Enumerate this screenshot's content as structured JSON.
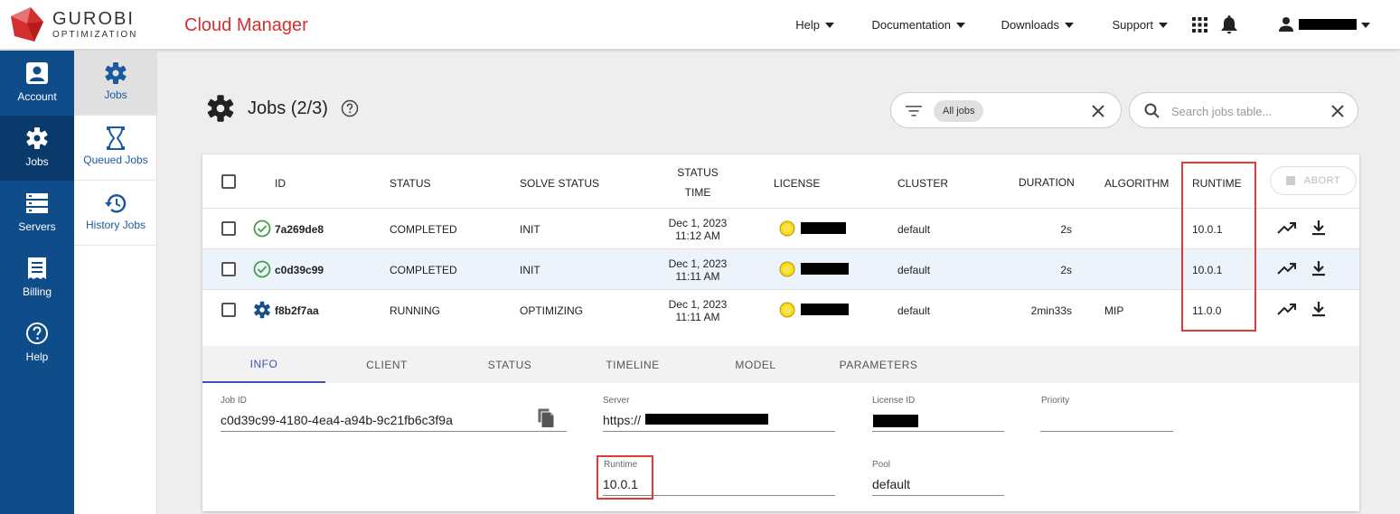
{
  "header": {
    "logo_main": "GUROBI",
    "logo_sub": "OPTIMIZATION",
    "app_title": "Cloud Manager",
    "nav": [
      "Help",
      "Documentation",
      "Downloads",
      "Support"
    ]
  },
  "sidebar": {
    "primary": [
      "Account",
      "Jobs",
      "Servers",
      "Billing",
      "Help"
    ],
    "secondary": [
      "Jobs",
      "Queued Jobs",
      "History Jobs"
    ]
  },
  "page": {
    "title": "Jobs (2/3)",
    "filter_chip": "All jobs",
    "search_placeholder": "Search jobs table..."
  },
  "table": {
    "columns": {
      "id": "ID",
      "status": "STATUS",
      "solve_status": "SOLVE STATUS",
      "status_time_1": "STATUS",
      "status_time_2": "TIME",
      "license": "LICENSE",
      "cluster": "CLUSTER",
      "duration": "DURATION",
      "algorithm": "ALGORITHM",
      "runtime": "RUNTIME"
    },
    "abort_label": "ABORT",
    "rows": [
      {
        "id": "7a269de8",
        "status": "COMPLETED",
        "solve_status": "INIT",
        "date": "Dec 1, 2023",
        "time": "11:12 AM",
        "cluster": "default",
        "duration": "2s",
        "algorithm": "",
        "runtime": "10.0.1",
        "status_icon": "check-circle-icon"
      },
      {
        "id": "c0d39c99",
        "status": "COMPLETED",
        "solve_status": "INIT",
        "date": "Dec 1, 2023",
        "time": "11:11 AM",
        "cluster": "default",
        "duration": "2s",
        "algorithm": "",
        "runtime": "10.0.1",
        "status_icon": "check-circle-icon"
      },
      {
        "id": "f8b2f7aa",
        "status": "RUNNING",
        "solve_status": "OPTIMIZING",
        "date": "Dec 1, 2023",
        "time": "11:11 AM",
        "cluster": "default",
        "duration": "2min33s",
        "algorithm": "MIP",
        "runtime": "11.0.0",
        "status_icon": "gear-icon"
      }
    ]
  },
  "details": {
    "tabs": [
      "INFO",
      "CLIENT",
      "STATUS",
      "TIMELINE",
      "MODEL",
      "PARAMETERS"
    ],
    "job_id_label": "Job ID",
    "job_id_value": "c0d39c99-4180-4ea4-a94b-9c21fb6c3f9a",
    "server_label": "Server",
    "server_value": "https://",
    "license_label": "License ID",
    "priority_label": "Priority",
    "runtime_label": "Runtime",
    "runtime_value": "10.0.1",
    "pool_label": "Pool",
    "pool_value": "default"
  },
  "colors": {
    "brand_red": "#d32f2f",
    "sidebar_blue": "#0f4c8a",
    "completed_green": "#43a047",
    "highlight_red": "#e53935",
    "tab_active": "#3f51b5"
  }
}
